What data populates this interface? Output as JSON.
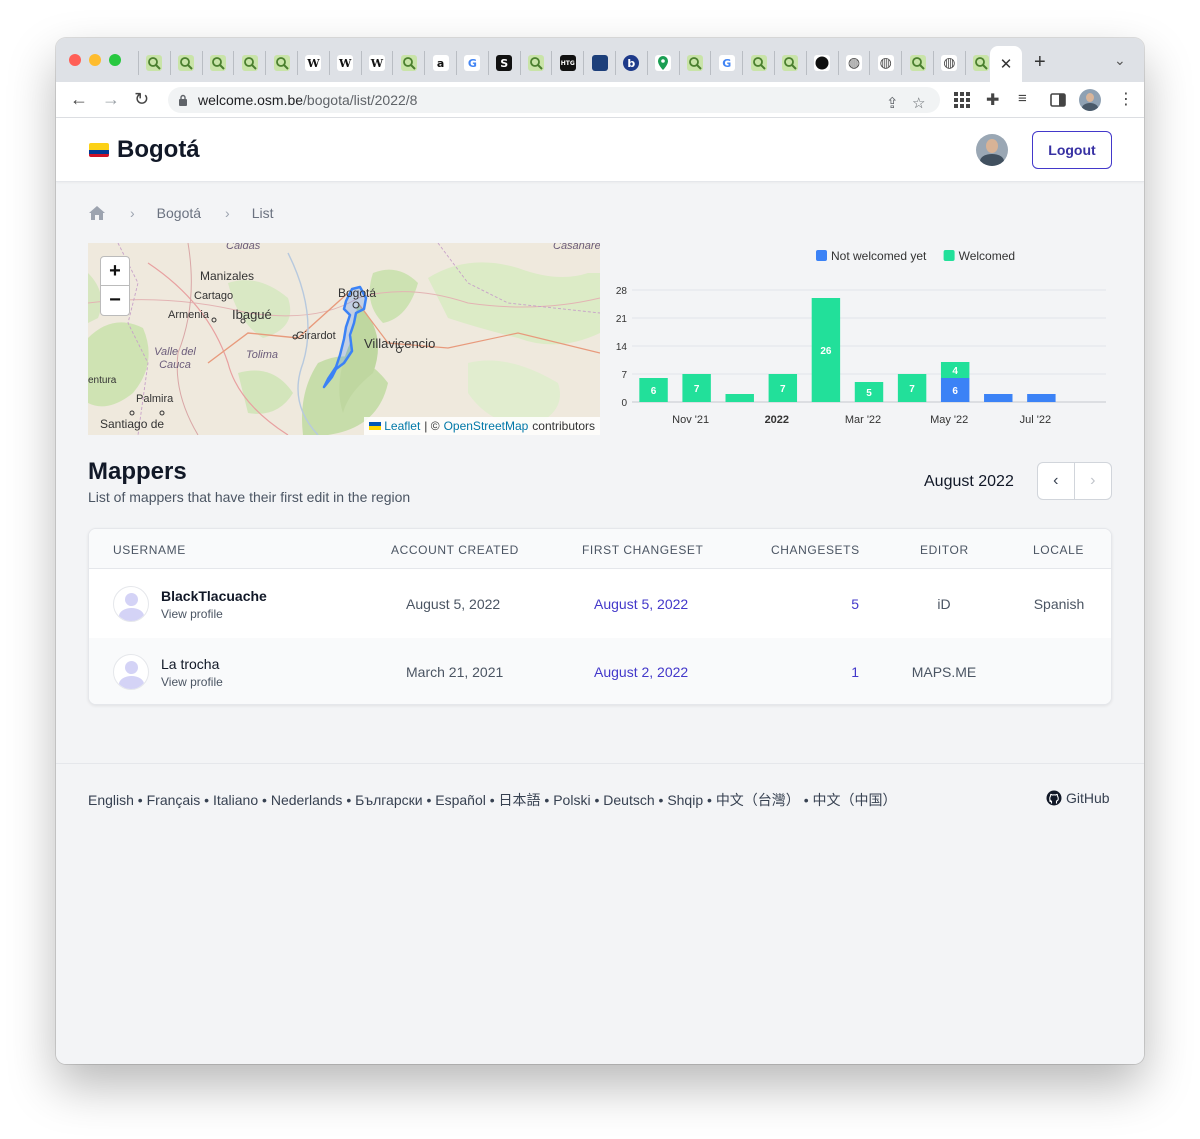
{
  "browser": {
    "url_host": "welcome.osm.be",
    "url_path": "/bogota/list/2022/8",
    "tab_favicons": [
      "osm",
      "osm",
      "osm",
      "osm",
      "osm",
      "wikipedia",
      "wikipedia",
      "wikipedia",
      "osm",
      "amazon",
      "google",
      "s-logo",
      "osm",
      "htg",
      "newspaper",
      "b-logo",
      "maps-pin",
      "osm",
      "google",
      "osm",
      "osm",
      "github",
      "globe",
      "globe",
      "osm",
      "globe",
      "osm"
    ],
    "tab_glyphs": {
      "wikipedia": "W",
      "amazon": "a",
      "google": "G",
      "s-logo": "S",
      "htg": "HTG",
      "b-logo": "b",
      "globe": "◍"
    },
    "active_tab_close": "✕",
    "new_tab": "+",
    "tab_menu": "⌄"
  },
  "header": {
    "title": "Bogotá",
    "logout_label": "Logout"
  },
  "breadcrumb": {
    "home_icon": "home-icon",
    "items": [
      "Bogotá",
      "List"
    ]
  },
  "map": {
    "zoom_in": "+",
    "zoom_out": "−",
    "labels": [
      "Caldas",
      "Casanare",
      "Manizales",
      "Cartago",
      "Armenia",
      "Ibagué",
      "Bogotá",
      "Girardot",
      "Villavicencio",
      "Valle del Cauca",
      "Tolima",
      "entura",
      "Palmira",
      "Santiago de"
    ],
    "attribution": {
      "leaflet": "Leaflet",
      "sep": "| ©",
      "osm": "OpenStreetMap",
      "suffix": "contributors"
    }
  },
  "chart_data": {
    "type": "bar",
    "stacked": true,
    "legend": [
      "Not welcomed yet",
      "Welcomed"
    ],
    "legend_position": "top",
    "colors": {
      "Not welcomed yet": "#3b82f6",
      "Welcomed": "#22e09a"
    },
    "categories": [
      "Oct '21",
      "Nov '21",
      "Dec '21",
      "Jan '22",
      "Feb '22",
      "Mar '22",
      "Apr '22",
      "May '22",
      "Jun '22",
      "Jul '22",
      "Aug '22"
    ],
    "series": [
      {
        "name": "Welcomed",
        "values": [
          6,
          7,
          2,
          7,
          26,
          5,
          7,
          4,
          0,
          0,
          0
        ]
      },
      {
        "name": "Not welcomed yet",
        "values": [
          0,
          0,
          0,
          0,
          0,
          0,
          0,
          6,
          2,
          2,
          0
        ]
      }
    ],
    "x_tick_labels": [
      "Nov '21",
      "2022",
      "Mar '22",
      "May '22",
      "Jul '22"
    ],
    "y_ticks": [
      0,
      7,
      14,
      21,
      28
    ],
    "ylim": [
      0,
      28
    ],
    "grid": true
  },
  "mappers": {
    "title": "Mappers",
    "subtitle": "List of mappers that have their first edit in the region",
    "month": "August 2022",
    "prev_icon": "‹",
    "next_icon": "›",
    "columns": [
      "Username",
      "Account created",
      "First changeset",
      "Changesets",
      "Editor",
      "Locale"
    ],
    "rows": [
      {
        "username": "BlackTlacuache",
        "view_profile": "View profile",
        "account_created": "August 5, 2022",
        "first_changeset": "August 5, 2022",
        "changesets": "5",
        "editor": "iD",
        "locale": "Spanish"
      },
      {
        "username": "La trocha",
        "view_profile": "View profile",
        "account_created": "March 21, 2021",
        "first_changeset": "August 2, 2022",
        "changesets": "1",
        "editor": "MAPS.ME",
        "locale": ""
      }
    ]
  },
  "footer": {
    "languages": [
      "English",
      "Français",
      "Italiano",
      "Nederlands",
      "Български",
      "Español",
      "日本語",
      "Polski",
      "Deutsch",
      "Shqip",
      "中文（台灣）",
      "中文（中国）"
    ],
    "lang_sep": " • ",
    "github": "GitHub"
  }
}
